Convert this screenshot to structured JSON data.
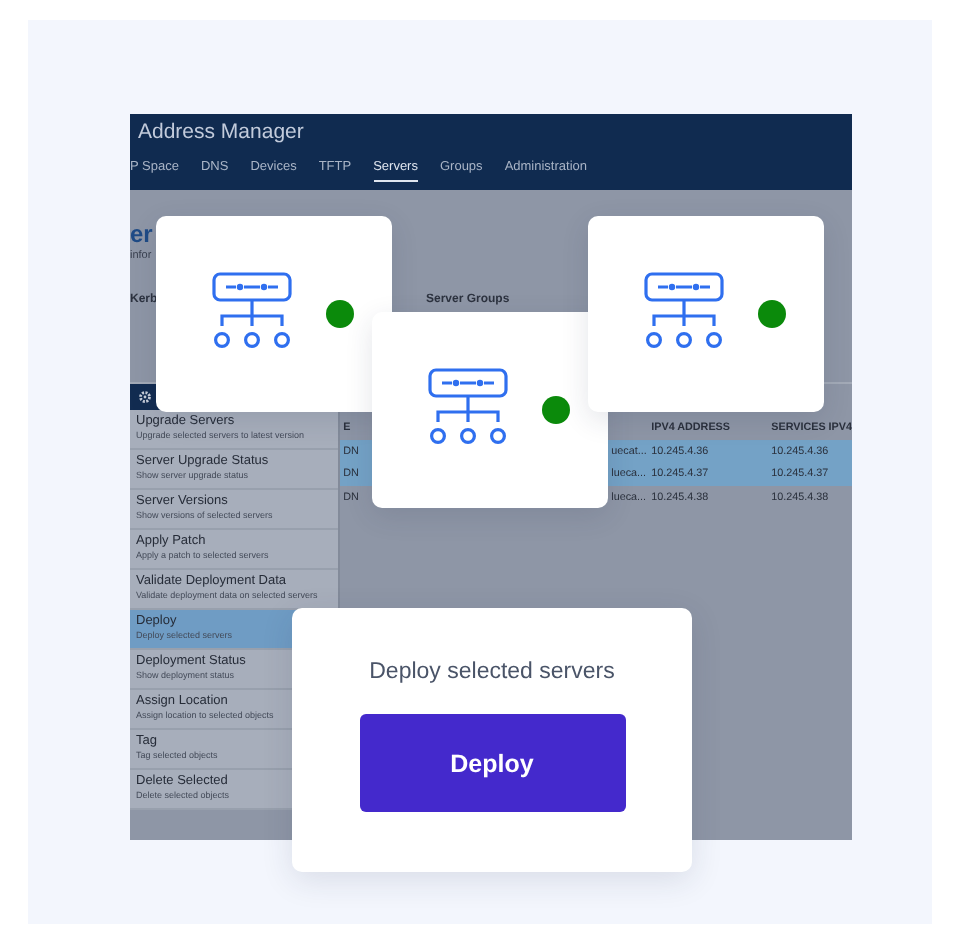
{
  "app": {
    "title": "Address Manager",
    "tabs": [
      {
        "label": "P Space",
        "selected": false
      },
      {
        "label": "DNS",
        "selected": false
      },
      {
        "label": "Devices",
        "selected": false
      },
      {
        "label": "TFTP",
        "selected": false
      },
      {
        "label": "Servers",
        "selected": true
      },
      {
        "label": "Groups",
        "selected": false
      },
      {
        "label": "Administration",
        "selected": false
      }
    ]
  },
  "page": {
    "heading": "er",
    "subtitle": "infor",
    "field_label": "Kerb",
    "section_label": "Server Groups"
  },
  "action_menu": {
    "items": [
      {
        "title": "Upgrade Servers",
        "description": "Upgrade selected servers to latest version",
        "selected": false
      },
      {
        "title": "Server Upgrade Status",
        "description": "Show server upgrade status",
        "selected": false
      },
      {
        "title": "Server Versions",
        "description": "Show versions of selected servers",
        "selected": false
      },
      {
        "title": "Apply Patch",
        "description": "Apply a patch to selected servers",
        "selected": false
      },
      {
        "title": "Validate Deployment Data",
        "description": "Validate deployment data on selected servers",
        "selected": false
      },
      {
        "title": "Deploy",
        "description": "Deploy selected servers",
        "selected": true
      },
      {
        "title": "Deployment Status",
        "description": "Show deployment status",
        "selected": false
      },
      {
        "title": "Assign Location",
        "description": "Assign location to selected objects",
        "selected": false
      },
      {
        "title": "Tag",
        "description": "Tag selected objects",
        "selected": false
      },
      {
        "title": "Delete Selected",
        "description": "Delete selected objects",
        "selected": false
      }
    ]
  },
  "table": {
    "columns": [
      "E",
      "",
      "IPV4 ADDRESS",
      "SERVICES IPV4"
    ],
    "rows": [
      {
        "cells": [
          "DN",
          "uecat...",
          "10.245.4.36",
          "10.245.4.36"
        ],
        "selected": true
      },
      {
        "cells": [
          "DN",
          "lueca...",
          "10.245.4.37",
          "10.245.4.37"
        ],
        "selected": true
      },
      {
        "cells": [
          "DN",
          "lueca...",
          "10.245.4.38",
          "10.245.4.38"
        ],
        "selected": false
      }
    ]
  },
  "server_cards": [
    {
      "online": true
    },
    {
      "online": true
    },
    {
      "online": true
    }
  ],
  "deploy_card": {
    "message": "Deploy selected servers",
    "button": "Deploy"
  }
}
